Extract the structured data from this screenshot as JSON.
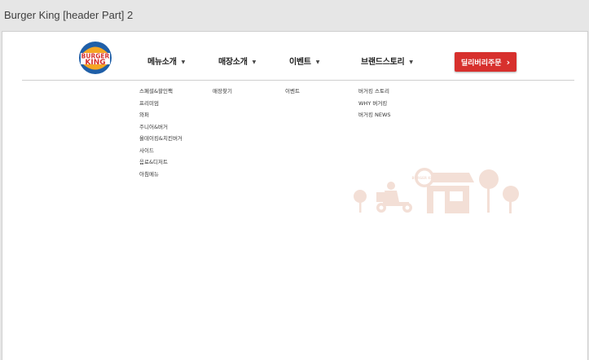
{
  "window": {
    "title": "Burger King [header Part] 2"
  },
  "logo": {
    "text_top": "BURGER",
    "text_bottom": "KING",
    "colors": {
      "bun": "#f5a623",
      "text": "#d7302d",
      "ring": "#1f5fa8"
    }
  },
  "nav": [
    {
      "label": "메뉴소개"
    },
    {
      "label": "매장소개"
    },
    {
      "label": "이벤트"
    },
    {
      "label": "브랜드스토리"
    }
  ],
  "delivery_button": {
    "label": "딜리버리주문",
    "color": "#d7302d"
  },
  "submenus": {
    "menu": [
      "스페셜&할인팩",
      "프리미엄",
      "와퍼",
      "주니어&버거",
      "올데이킹&치킨버거",
      "사이드",
      "음료&디저트",
      "아침메뉴"
    ],
    "store": [
      "매장찾기"
    ],
    "event": [
      "이벤트"
    ],
    "brand": [
      "버거킹 스토리",
      "WHY 버거킹",
      "버거킹 NEWS"
    ]
  },
  "illustration": {
    "badge_text": "BURGER KING",
    "icon": "delivery-store-illustration",
    "color": "#f3dfd6"
  }
}
